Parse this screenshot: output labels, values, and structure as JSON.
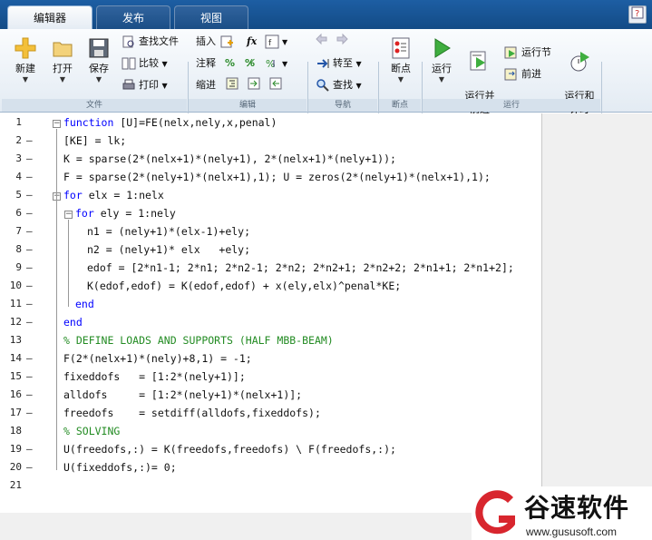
{
  "tabs": [
    {
      "label": "编辑器"
    },
    {
      "label": "发布"
    },
    {
      "label": "视图"
    }
  ],
  "help_icon": "help-icon",
  "ribbon": {
    "file_group": {
      "label": "文件",
      "new": "新建",
      "open": "打开",
      "save": "保存",
      "find_files": "查找文件",
      "compare": "比较",
      "print": "打印"
    },
    "edit_group": {
      "label": "编辑",
      "insert": "插入",
      "comment": "注释",
      "indent": "缩进",
      "fx": "fx"
    },
    "nav_group": {
      "label": "导航",
      "goto": "转至",
      "find": "查找"
    },
    "breakpoint_group": {
      "label": "断点",
      "breakpoints": "断点"
    },
    "run_group": {
      "label": "运行",
      "run": "运行",
      "run_advance": "运行并\n前进",
      "run_section": "运行节",
      "advance": "前进",
      "run_time": "运行和\n计时"
    }
  },
  "editor": {
    "lines": [
      {
        "n": "1",
        "dash": "",
        "code": "function [U]=FE(nelx,nely,x,penal)"
      },
      {
        "n": "2",
        "dash": "—",
        "code": "[KE] = lk;"
      },
      {
        "n": "3",
        "dash": "—",
        "code": "K = sparse(2*(nelx+1)*(nely+1), 2*(nelx+1)*(nely+1));"
      },
      {
        "n": "4",
        "dash": "—",
        "code": "F = sparse(2*(nely+1)*(nelx+1),1); U = zeros(2*(nely+1)*(nelx+1),1);"
      },
      {
        "n": "5",
        "dash": "—",
        "code": "for elx = 1:nelx"
      },
      {
        "n": "6",
        "dash": "—",
        "code": "for ely = 1:nely"
      },
      {
        "n": "7",
        "dash": "—",
        "code": "n1 = (nely+1)*(elx-1)+ely;"
      },
      {
        "n": "8",
        "dash": "—",
        "code": "n2 = (nely+1)* elx   +ely;"
      },
      {
        "n": "9",
        "dash": "—",
        "code": "edof = [2*n1-1; 2*n1; 2*n2-1; 2*n2; 2*n2+1; 2*n2+2; 2*n1+1; 2*n1+2];"
      },
      {
        "n": "10",
        "dash": "—",
        "code": "K(edof,edof) = K(edof,edof) + x(ely,elx)^penal*KE;"
      },
      {
        "n": "11",
        "dash": "—",
        "code": "end"
      },
      {
        "n": "12",
        "dash": "—",
        "code": "end"
      },
      {
        "n": "13",
        "dash": "",
        "code": "% DEFINE LOADS AND SUPPORTS (HALF MBB-BEAM)"
      },
      {
        "n": "14",
        "dash": "—",
        "code": "F(2*(nelx+1)*(nely)+8,1) = -1;"
      },
      {
        "n": "15",
        "dash": "—",
        "code": "fixeddofs   = [1:2*(nely+1)];"
      },
      {
        "n": "16",
        "dash": "—",
        "code": "alldofs     = [1:2*(nely+1)*(nelx+1)];"
      },
      {
        "n": "17",
        "dash": "—",
        "code": "freedofs    = setdiff(alldofs,fixeddofs);"
      },
      {
        "n": "18",
        "dash": "",
        "code": "% SOLVING"
      },
      {
        "n": "19",
        "dash": "—",
        "code": "U(freedofs,:) = K(freedofs,freedofs) \\ F(freedofs,:);"
      },
      {
        "n": "20",
        "dash": "—",
        "code": "U(fixeddofs,:)= 0;"
      },
      {
        "n": "21",
        "dash": "",
        "code": ""
      }
    ]
  },
  "watermark": {
    "name": "谷速软件",
    "url": "www.gususoft.com"
  },
  "colors": {
    "keyword": "#0000ff",
    "comment": "#228b22",
    "titlebar": "#1d5ea3"
  }
}
